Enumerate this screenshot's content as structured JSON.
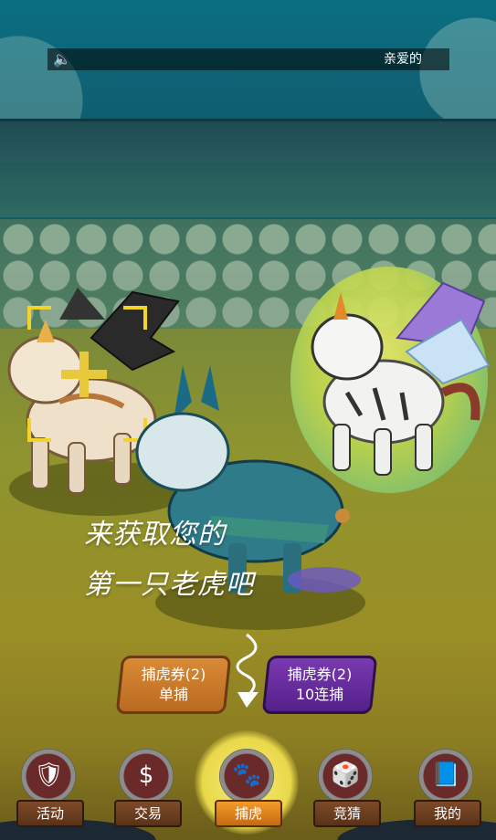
{
  "topbar": {
    "marquee_text": "亲爱的"
  },
  "prompt": {
    "line1": "来获取您的",
    "line2": "第一只老虎吧"
  },
  "capture_buttons": {
    "single": {
      "title": "捕虎券(2)",
      "subtitle": "单捕"
    },
    "ten": {
      "title": "捕虎券(2)",
      "subtitle": "10连捕"
    }
  },
  "nav": {
    "items": [
      {
        "label": "活动",
        "icon": "shield-icon"
      },
      {
        "label": "交易",
        "icon": "money-bag-icon"
      },
      {
        "label": "捕虎",
        "icon": "paw-icon",
        "active": true
      },
      {
        "label": "竞猜",
        "icon": "dice-icon"
      },
      {
        "label": "我的",
        "icon": "book-icon"
      }
    ]
  },
  "colors": {
    "accent_yellow": "#f3d22a",
    "orange_button": "#d98a35",
    "purple_button": "#7a3ab1"
  }
}
